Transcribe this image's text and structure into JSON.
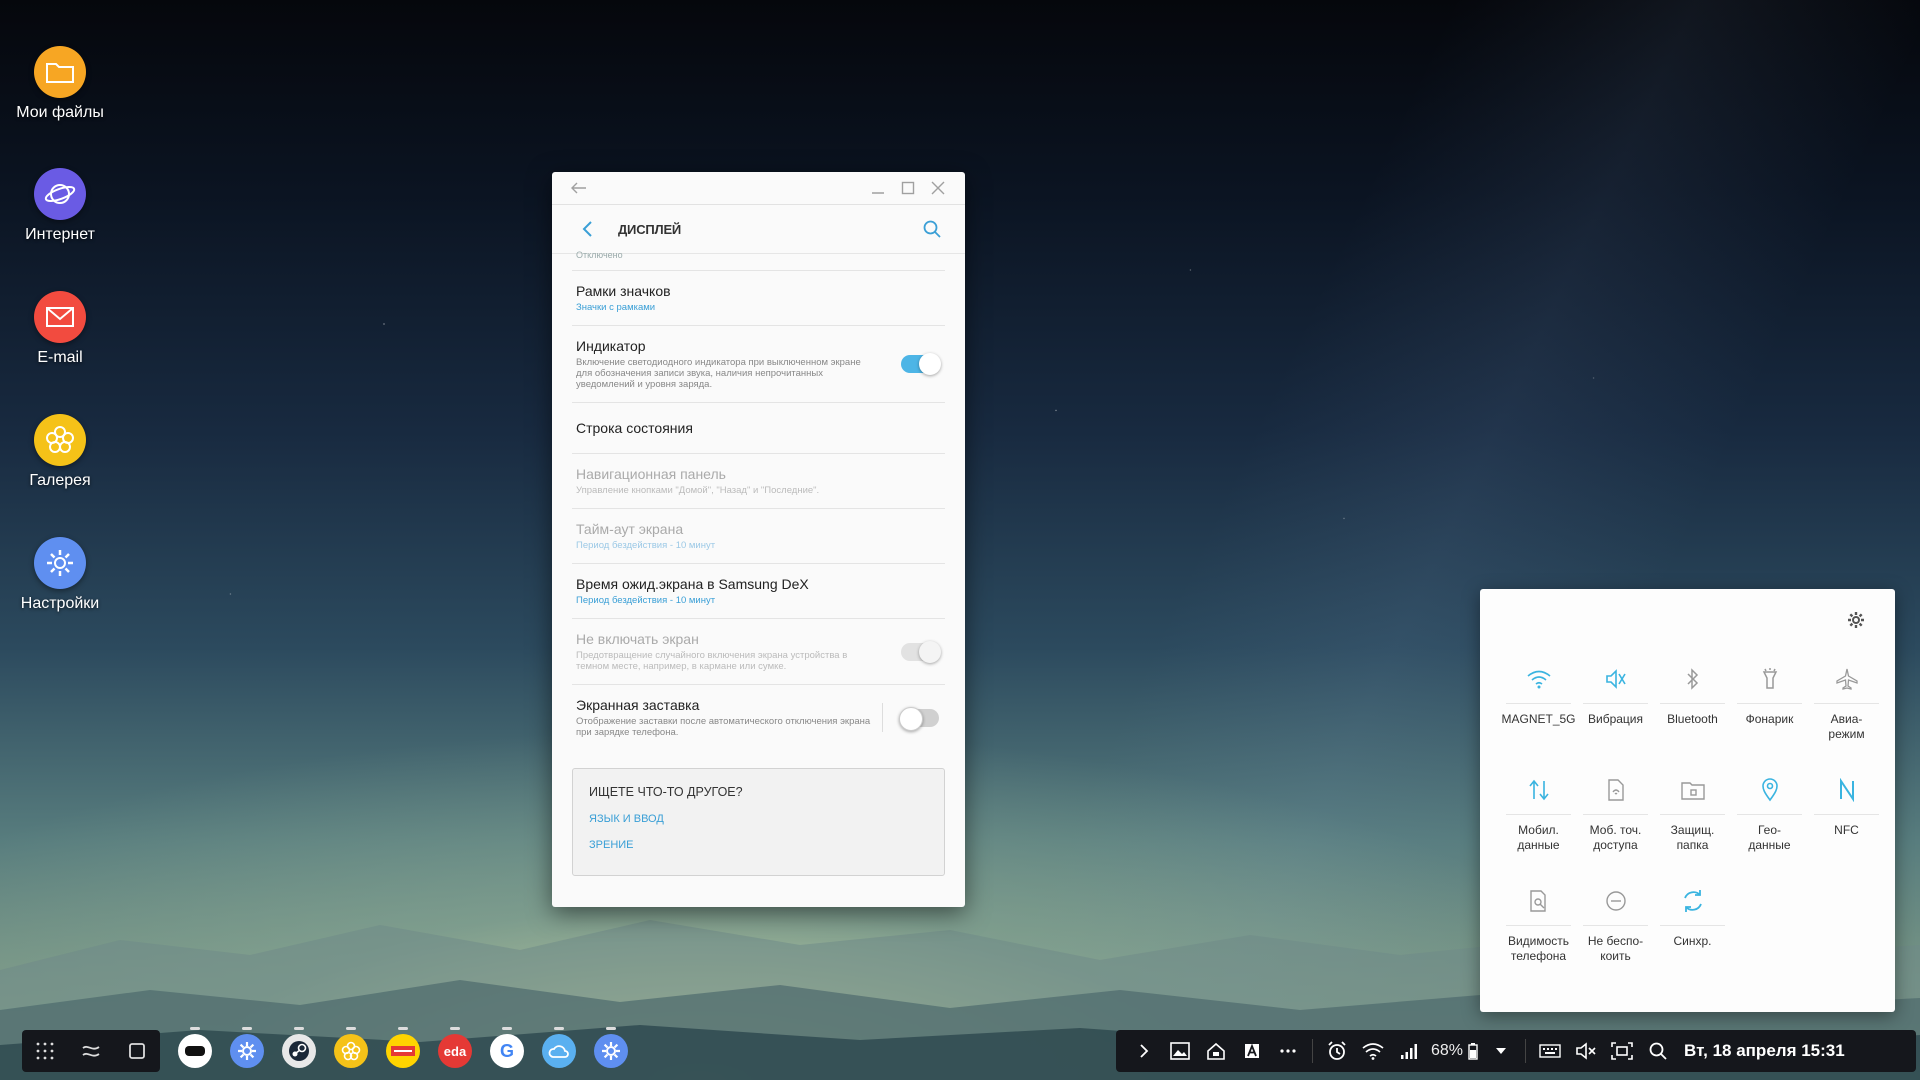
{
  "desktop": {
    "icons": [
      {
        "label": "Мои файлы",
        "icon": "folder-icon",
        "color": "#f7a623"
      },
      {
        "label": "Интернет",
        "icon": "planet-icon",
        "color": "#6a5be4"
      },
      {
        "label": "E-mail",
        "icon": "envelope-icon",
        "color": "#f24b3f"
      },
      {
        "label": "Галерея",
        "icon": "flower-icon",
        "color": "#f5c218"
      },
      {
        "label": "Настройки",
        "icon": "gear-icon",
        "color": "#5f8ff0"
      }
    ]
  },
  "window": {
    "title": "ДИСПЛЕЙ",
    "cut_text": "Отключено",
    "items": [
      {
        "title": "Рамки значков",
        "subtitle": "Значки с рамками",
        "sub_style": "blue",
        "state": "none"
      },
      {
        "title": "Индикатор",
        "subtitle": "Включение светодиодного индикатора при выключенном экране для обозначения записи звука, наличия непрочитанных уведомлений и уровня заряда.",
        "sub_style": "gray",
        "state": "on"
      },
      {
        "title": "Строка состояния",
        "subtitle": "",
        "sub_style": "gray",
        "state": "none"
      },
      {
        "title": "Навигационная панель",
        "subtitle": "Управление кнопками \"Домой\", \"Назад\" и \"Последние\".",
        "sub_style": "gray",
        "state": "disabled"
      },
      {
        "title": "Тайм-аут экрана",
        "subtitle": "Период бездействия - 10 минут",
        "sub_style": "blue",
        "state": "disabled"
      },
      {
        "title": "Время ожид.экрана в Samsung DeX",
        "subtitle": "Период бездействия - 10 минут",
        "sub_style": "blue",
        "state": "none"
      },
      {
        "title": "Не включать экран",
        "subtitle": "Предотвращение случайного включения экрана устройства в темном месте, например, в кармане или сумке.",
        "sub_style": "gray",
        "state": "disabled-toggle"
      },
      {
        "title": "Экранная заставка",
        "subtitle": "Отображение заставки после автоматического отключения экрана при зарядке телефона.",
        "sub_style": "gray",
        "state": "off"
      }
    ],
    "lookbox": {
      "heading": "ИЩЕТЕ ЧТО-ТО ДРУГОЕ?",
      "links": [
        "ЯЗЫК И ВВОД",
        "ЗРЕНИЕ"
      ]
    }
  },
  "quick_panel": {
    "accent": "#3ab4e0",
    "tiles": [
      {
        "label": "MAGNET_5G",
        "icon": "wifi-icon",
        "active": true
      },
      {
        "label": "Вибрация",
        "icon": "vibrate-icon",
        "active": true
      },
      {
        "label": "Bluetooth",
        "icon": "bluetooth-icon",
        "active": false
      },
      {
        "label": "Фонарик",
        "icon": "flashlight-icon",
        "active": false
      },
      {
        "label": "Авиа-\nрежим",
        "icon": "airplane-icon",
        "active": false
      },
      {
        "label": "Мобил.\nданные",
        "icon": "mobile-data-icon",
        "active": true
      },
      {
        "label": "Моб. точ.\nдоступа",
        "icon": "hotspot-icon",
        "active": false
      },
      {
        "label": "Защищ.\nпапка",
        "icon": "secure-folder-icon",
        "active": false
      },
      {
        "label": "Гео-\nданные",
        "icon": "location-icon",
        "active": true
      },
      {
        "label": "NFC",
        "icon": "nfc-icon",
        "active": true
      },
      {
        "label": "Видимость\nтелефона",
        "icon": "visibility-icon",
        "active": false
      },
      {
        "label": "Не беспо-\nкоить",
        "icon": "dnd-icon",
        "active": false
      },
      {
        "label": "Синхр.",
        "icon": "sync-icon",
        "active": true
      }
    ]
  },
  "taskbar": {
    "apps": [
      {
        "name": "gear-vr-app",
        "text": "",
        "color": "#ffffff"
      },
      {
        "name": "settings-app",
        "text": "",
        "color": "#5f8ff0"
      },
      {
        "name": "steam-app",
        "text": "",
        "color": "#e8e8e8"
      },
      {
        "name": "gallery-app",
        "text": "",
        "color": "#f5c218"
      },
      {
        "name": "news-app",
        "text": "",
        "color": "#ffd400"
      },
      {
        "name": "eda-app",
        "text": "eda",
        "color": "#e53935"
      },
      {
        "name": "google-app",
        "text": "G",
        "color": "#ffffff"
      },
      {
        "name": "weather-app",
        "text": "",
        "color": "#5ab0f0"
      },
      {
        "name": "settings-app-2",
        "text": "",
        "color": "#5f8ff0"
      }
    ],
    "battery": "68%",
    "datetime": "Вт, 18 апреля 15:31"
  }
}
